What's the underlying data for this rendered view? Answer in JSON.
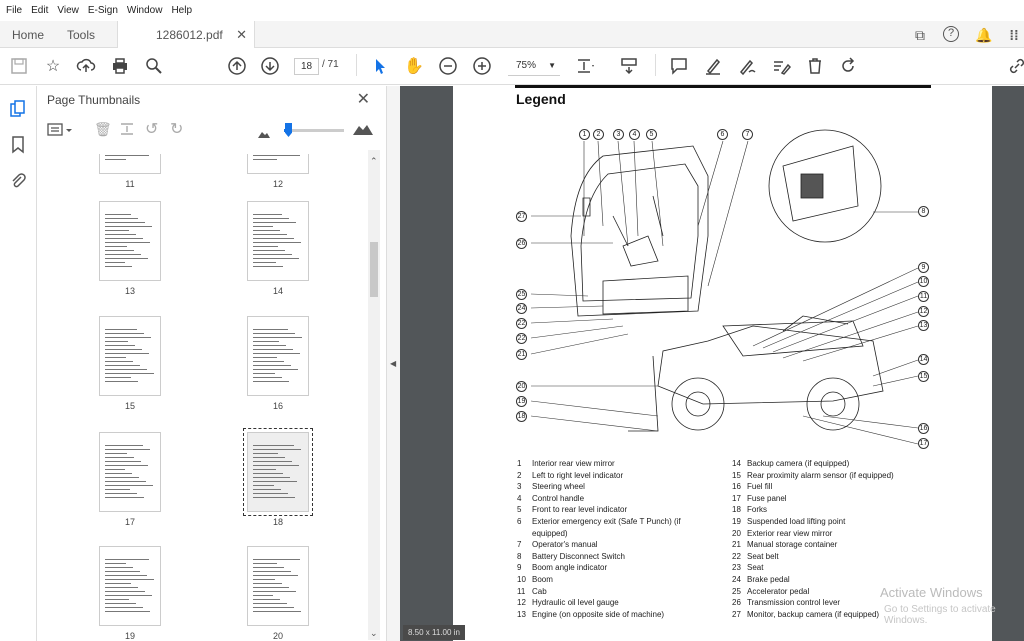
{
  "menu": [
    "File",
    "Edit",
    "View",
    "E-Sign",
    "Window",
    "Help"
  ],
  "tabs": {
    "home": "Home",
    "tools": "Tools",
    "doc": "1286012.pdf"
  },
  "toolbar": {
    "page_current": "18",
    "page_total": "/ 71",
    "zoom": "75%"
  },
  "panel": {
    "title": "Page Thumbnails"
  },
  "thumbnails": [
    "11",
    "12",
    "13",
    "14",
    "15",
    "16",
    "17",
    "18",
    "19",
    "20"
  ],
  "selected_page": "18",
  "legend": {
    "title": "Legend",
    "left_items": [
      {
        "n": "1",
        "t": "Interior rear view mirror"
      },
      {
        "n": "2",
        "t": "Left to right level indicator"
      },
      {
        "n": "3",
        "t": "Steering wheel"
      },
      {
        "n": "4",
        "t": "Control handle"
      },
      {
        "n": "5",
        "t": "Front to rear level indicator"
      },
      {
        "n": "6",
        "t": "Exterior emergency exit (Safe T Punch) (if"
      },
      {
        "n": "",
        "t": "equipped)"
      },
      {
        "n": "7",
        "t": "Operator's manual"
      },
      {
        "n": "8",
        "t": "Battery Disconnect Switch"
      },
      {
        "n": "9",
        "t": "Boom angle indicator"
      },
      {
        "n": "10",
        "t": "Boom"
      },
      {
        "n": "11",
        "t": "Cab"
      },
      {
        "n": "12",
        "t": "Hydraulic oil level gauge"
      },
      {
        "n": "13",
        "t": "Engine (on opposite side of machine)"
      }
    ],
    "right_items": [
      {
        "n": "14",
        "t": "Backup camera (if equipped)"
      },
      {
        "n": "15",
        "t": "Rear proximity alarm sensor (if equipped)"
      },
      {
        "n": "16",
        "t": "Fuel fill"
      },
      {
        "n": "17",
        "t": "Fuse panel"
      },
      {
        "n": "18",
        "t": "Forks"
      },
      {
        "n": "19",
        "t": "Suspended load lifting point"
      },
      {
        "n": "20",
        "t": "Exterior rear view mirror"
      },
      {
        "n": "21",
        "t": "Manual storage container"
      },
      {
        "n": "22",
        "t": "Seat belt"
      },
      {
        "n": "23",
        "t": "Seat"
      },
      {
        "n": "24",
        "t": "Brake pedal"
      },
      {
        "n": "25",
        "t": "Accelerator pedal"
      },
      {
        "n": "26",
        "t": "Transmission control lever"
      },
      {
        "n": "27",
        "t": "Monitor, backup camera (if equipped)"
      }
    ],
    "callouts_top": [
      "1",
      "2",
      "3",
      "4",
      "5",
      "6",
      "7"
    ],
    "callouts_left": [
      "27",
      "26",
      "25",
      "24",
      "22",
      "22",
      "21",
      "20",
      "19",
      "18"
    ],
    "callouts_right": [
      "8",
      "9",
      "10",
      "11",
      "12",
      "13",
      "14",
      "15",
      "16",
      "17"
    ]
  },
  "page_size": "8.50 x 11.00 in",
  "watermark": {
    "line1": "Activate Windows",
    "line2": "Go to Settings to activate Windows."
  }
}
